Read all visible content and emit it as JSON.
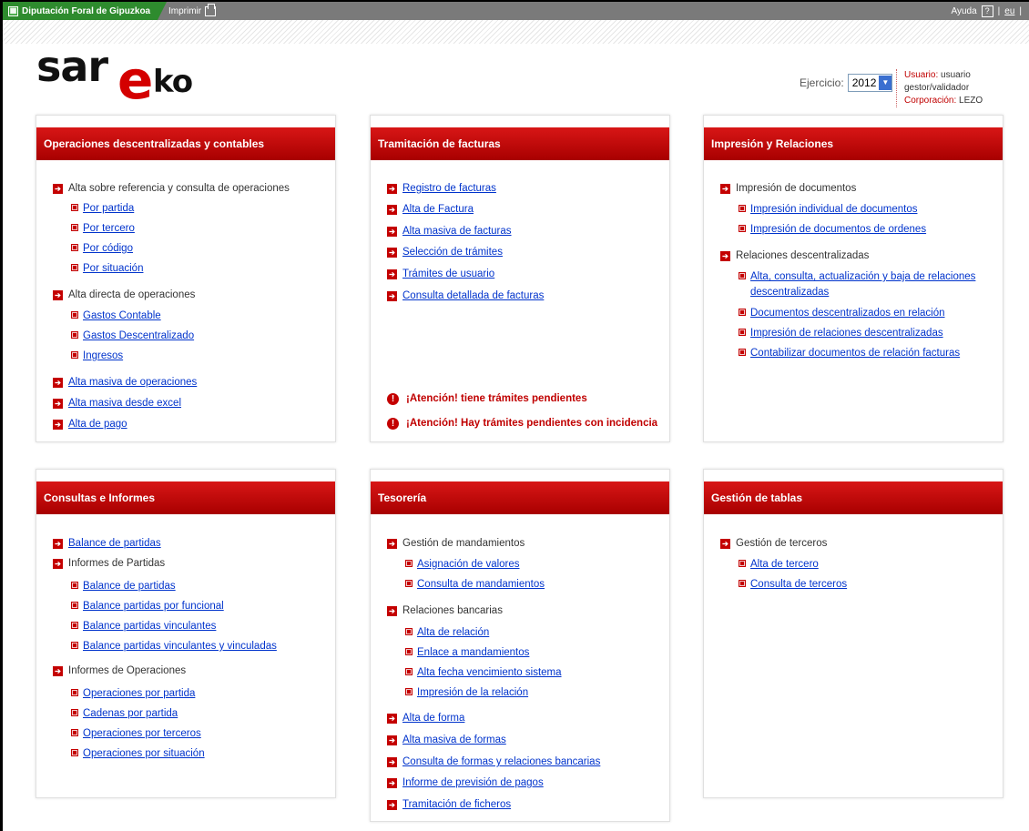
{
  "topbar": {
    "brand": "Diputación Foral de Gipuzkoa",
    "print": "Imprimir",
    "help": "Ayuda",
    "help_icon_text": "?",
    "sep": "|",
    "lang": "eu"
  },
  "logo": {
    "part1": "sar",
    "part2": "e",
    "part3": "ko"
  },
  "ejercicio": {
    "label": "Ejercicio:",
    "value": "2012"
  },
  "user": {
    "user_label": "Usuario:",
    "user_value": "usuario gestor/validador",
    "corp_label": "Corporación:",
    "corp_value": "LEZO"
  },
  "panels": {
    "ops": {
      "title": "Operaciones descentralizadas y contables",
      "g1": "Alta sobre referencia y consulta de operaciones",
      "g1_items": [
        "Por partida",
        "Por tercero",
        "Por código",
        "Por situación"
      ],
      "g2": "Alta directa de operaciones",
      "g2_items": [
        "Gastos Contable",
        "Gastos Descentralizado",
        "Ingresos"
      ],
      "l3": "Alta masiva de operaciones",
      "l4": "Alta masiva desde excel",
      "l5": "Alta de pago"
    },
    "facturas": {
      "title": "Tramitación de facturas",
      "items": [
        "Registro de facturas",
        "Alta de Factura",
        "Alta masiva de facturas",
        "Selección de trámites",
        "Trámites de usuario",
        "Consulta detallada de facturas"
      ],
      "warn1": "¡Atención! tiene trámites pendientes",
      "warn2": "¡Atención! Hay trámites pendientes con incidencia"
    },
    "impresion": {
      "title": "Impresión y Relaciones",
      "g1": "Impresión de documentos",
      "g1_items": [
        "Impresión individual de documentos",
        "Impresión de documentos de ordenes"
      ],
      "g2": "Relaciones descentralizadas",
      "g2_item1_a": "Alta, consulta, actualización y baja de relaciones",
      "g2_item1_b": "descentralizadas",
      "g2_items": [
        "Documentos descentralizados en relación",
        "Impresión de relaciones descentralizadas",
        "Contabilizar documentos de relación facturas"
      ]
    },
    "consultas": {
      "title": "Consultas e Informes",
      "l1": "Balance de partidas",
      "g1": "Informes de Partidas",
      "g1_items": [
        "Balance de partidas",
        "Balance partidas por funcional",
        "Balance partidas vinculantes",
        "Balance partidas vinculantes y vinculadas"
      ],
      "g2": "Informes de Operaciones",
      "g2_items": [
        "Operaciones por partida",
        "Cadenas por partida",
        "Operaciones por terceros",
        "Operaciones por situación"
      ]
    },
    "tesoreria": {
      "title": "Tesorería",
      "g1": "Gestión de mandamientos",
      "g1_items": [
        "Asignación de valores",
        "Consulta de mandamientos"
      ],
      "g2": "Relaciones bancarias",
      "g2_items": [
        "Alta de relación",
        "Enlace a mandamientos",
        "Alta fecha vencimiento sistema",
        "Impresión de la relación"
      ],
      "links": [
        "Alta de forma",
        "Alta masiva de formas",
        "Consulta de formas y relaciones bancarias",
        "Informe de previsión de pagos",
        "Tramitación de ficheros"
      ]
    },
    "tablas": {
      "title": "Gestión de tablas",
      "g1": "Gestión de terceros",
      "g1_items": [
        "Alta de tercero",
        "Consulta de terceros"
      ]
    }
  }
}
